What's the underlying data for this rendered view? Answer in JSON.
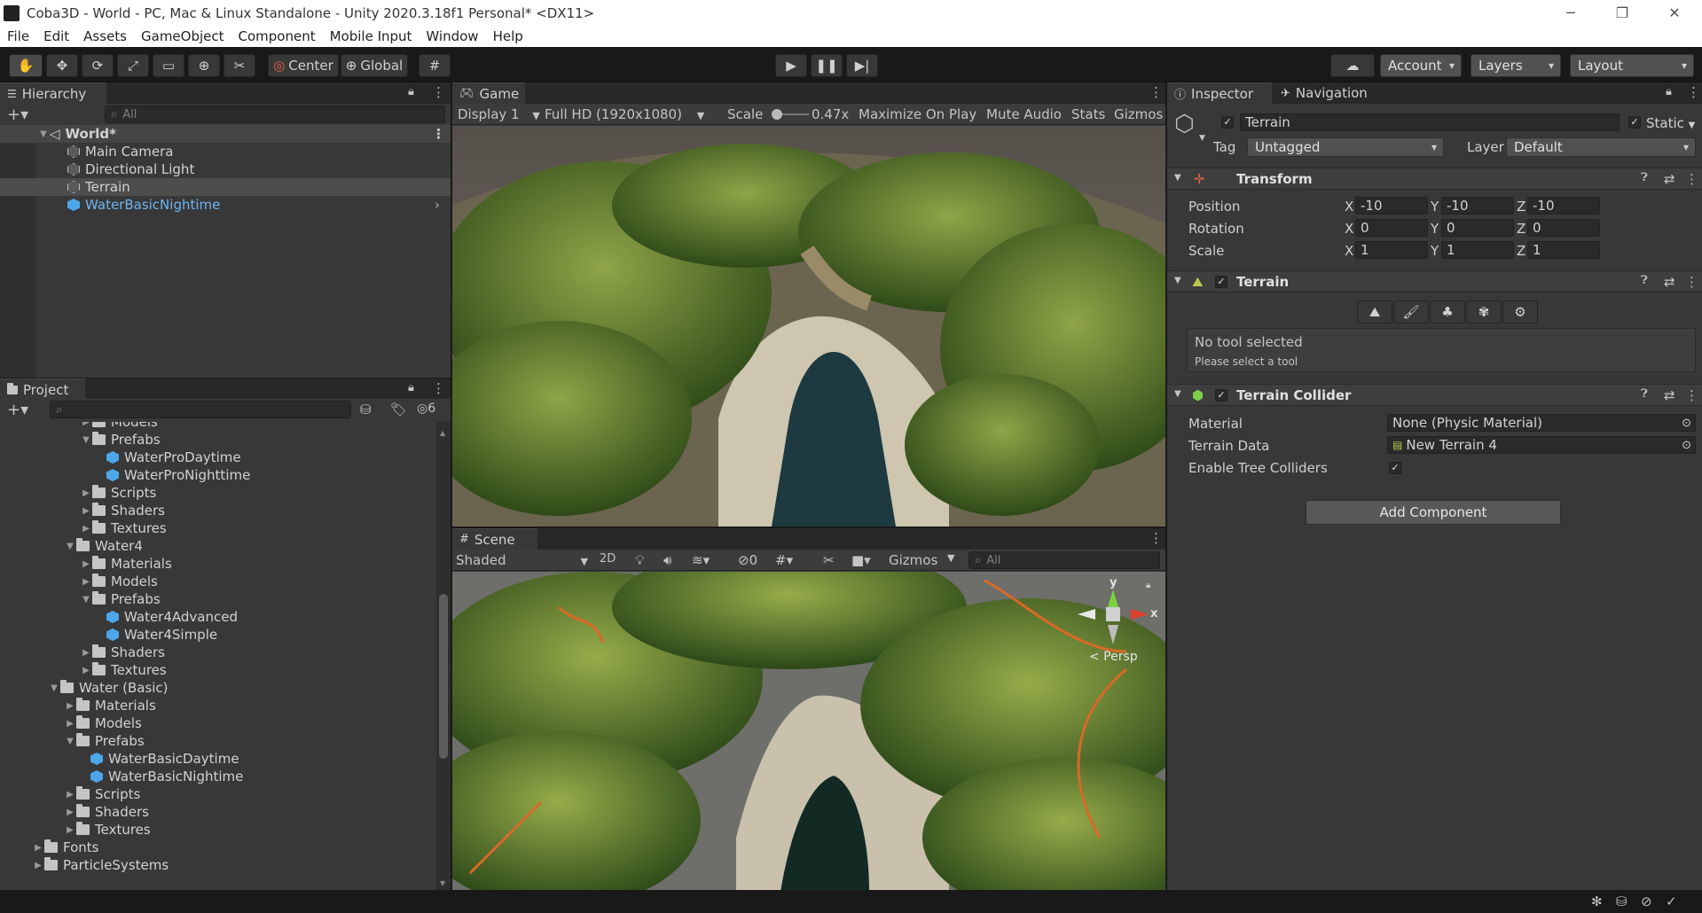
{
  "window": {
    "title": "Coba3D - World - PC, Mac & Linux Standalone - Unity 2020.3.18f1 Personal* <DX11>",
    "controls": [
      "─",
      "❐",
      "✕"
    ]
  },
  "menu": [
    "File",
    "Edit",
    "Assets",
    "GameObject",
    "Component",
    "Mobile Input",
    "Window",
    "Help"
  ],
  "toolbar": {
    "pivot": "Center",
    "space": "Global",
    "account": "Account",
    "layers": "Layers",
    "layout": "Layout"
  },
  "hierarchy": {
    "tab": "Hierarchy",
    "search_placeholder": "All",
    "scene": "World*",
    "items": [
      "Main Camera",
      "Directional Light",
      "Terrain",
      "WaterBasicNightime"
    ]
  },
  "project": {
    "tab": "Project",
    "hidden_count": "6",
    "items": [
      {
        "label": "Models",
        "indent": 5,
        "type": "folder",
        "open": false
      },
      {
        "label": "Prefabs",
        "indent": 5,
        "type": "folder",
        "open": true
      },
      {
        "label": "WaterProDaytime",
        "indent": 7,
        "type": "prefab"
      },
      {
        "label": "WaterProNighttime",
        "indent": 7,
        "type": "prefab"
      },
      {
        "label": "Scripts",
        "indent": 5,
        "type": "folder",
        "open": false
      },
      {
        "label": "Shaders",
        "indent": 5,
        "type": "folder",
        "open": false
      },
      {
        "label": "Textures",
        "indent": 5,
        "type": "folder",
        "open": false
      },
      {
        "label": "Water4",
        "indent": 4,
        "type": "folder",
        "open": true
      },
      {
        "label": "Materials",
        "indent": 5,
        "type": "folder",
        "open": false
      },
      {
        "label": "Models",
        "indent": 5,
        "type": "folder",
        "open": false
      },
      {
        "label": "Prefabs",
        "indent": 5,
        "type": "folder",
        "open": true
      },
      {
        "label": "Water4Advanced",
        "indent": 7,
        "type": "prefab"
      },
      {
        "label": "Water4Simple",
        "indent": 7,
        "type": "prefab"
      },
      {
        "label": "Shaders",
        "indent": 5,
        "type": "folder",
        "open": false
      },
      {
        "label": "Textures",
        "indent": 5,
        "type": "folder",
        "open": false
      },
      {
        "label": "Water (Basic)",
        "indent": 3,
        "type": "folder",
        "open": true
      },
      {
        "label": "Materials",
        "indent": 4,
        "type": "folder",
        "open": false
      },
      {
        "label": "Models",
        "indent": 4,
        "type": "folder",
        "open": false
      },
      {
        "label": "Prefabs",
        "indent": 4,
        "type": "folder",
        "open": true
      },
      {
        "label": "WaterBasicDaytime",
        "indent": 6,
        "type": "prefab"
      },
      {
        "label": "WaterBasicNightime",
        "indent": 6,
        "type": "prefab"
      },
      {
        "label": "Scripts",
        "indent": 4,
        "type": "folder",
        "open": false
      },
      {
        "label": "Shaders",
        "indent": 4,
        "type": "folder",
        "open": false
      },
      {
        "label": "Textures",
        "indent": 4,
        "type": "folder",
        "open": false
      },
      {
        "label": "Fonts",
        "indent": 2,
        "type": "folder",
        "open": false
      },
      {
        "label": "ParticleSystems",
        "indent": 2,
        "type": "folder",
        "open": false
      }
    ]
  },
  "game": {
    "tab": "Game",
    "display": "Display 1",
    "resolution": "Full HD (1920x1080)",
    "scale_label": "Scale",
    "scale_value": "0.47x",
    "maximize": "Maximize On Play",
    "mute": "Mute Audio",
    "stats": "Stats",
    "gizmos": "Gizmos"
  },
  "scene": {
    "tab": "Scene",
    "shading": "Shaded",
    "mode2d": "2D",
    "hidden_count": "0",
    "gizmos": "Gizmos",
    "search_placeholder": "All",
    "axis_y": "y",
    "axis_x": "x",
    "projection": "< Persp"
  },
  "inspector": {
    "tab": "Inspector",
    "tab2": "Navigation",
    "object_name": "Terrain",
    "static_label": "Static",
    "tag_label": "Tag",
    "tag_value": "Untagged",
    "layer_label": "Layer",
    "layer_value": "Default",
    "transform": {
      "title": "Transform",
      "position_label": "Position",
      "rotation_label": "Rotation",
      "scale_label": "Scale",
      "position": {
        "x": "-10",
        "y": "-10",
        "z": "-10"
      },
      "rotation": {
        "x": "0",
        "y": "0",
        "z": "0"
      },
      "scale": {
        "x": "1",
        "y": "1",
        "z": "1"
      }
    },
    "terrain": {
      "title": "Terrain",
      "no_tool": "No tool selected",
      "please_select": "Please select a tool"
    },
    "collider": {
      "title": "Terrain Collider",
      "material_label": "Material",
      "material_value": "None (Physic Material)",
      "data_label": "Terrain Data",
      "data_value": "New Terrain 4",
      "trees_label": "Enable Tree Colliders"
    },
    "add_component": "Add Component"
  },
  "colors": {
    "accent_blue": "#4ea6ea",
    "panel": "#383838",
    "dark": "#191919",
    "selected_row": "#4d4d4d"
  }
}
